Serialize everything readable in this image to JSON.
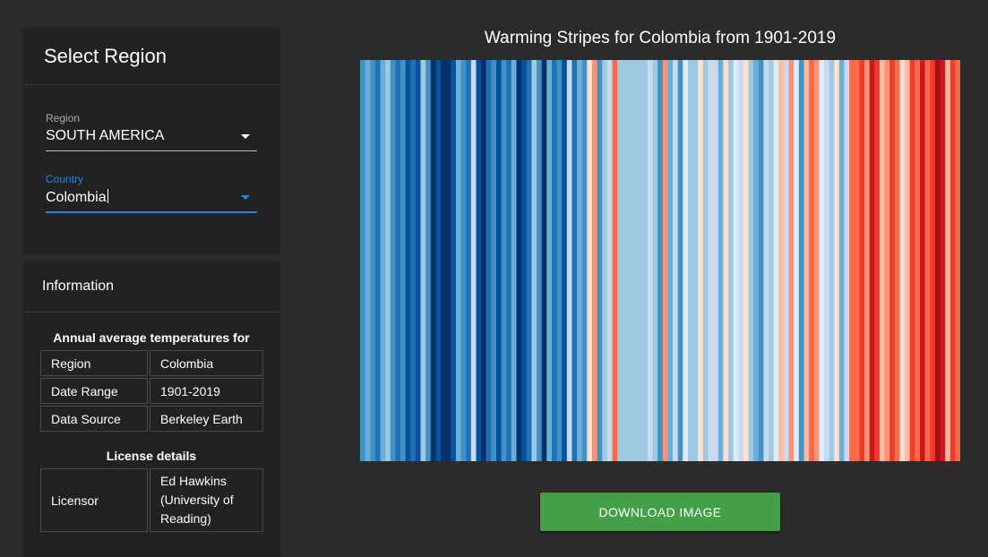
{
  "sidebar": {
    "select_title": "Select Region",
    "region_field": {
      "label": "Region",
      "value": "SOUTH AMERICA"
    },
    "country_field": {
      "label": "Country",
      "value": "Colombia"
    },
    "info_title": "Information",
    "annual_heading": "Annual average temperatures for",
    "details": [
      {
        "key": "Region",
        "value": "Colombia"
      },
      {
        "key": "Date Range",
        "value": "1901-2019"
      },
      {
        "key": "Data Source",
        "value": "Berkeley Earth"
      }
    ],
    "license_heading": "License details",
    "license": [
      {
        "key": "Licensor",
        "value": "Ed Hawkins (University of Reading)"
      }
    ]
  },
  "main": {
    "download_label": "DOWNLOAD IMAGE"
  },
  "colors": {
    "accent": "#1e88e5",
    "button": "#43a047",
    "palette": [
      "#08306b",
      "#08519c",
      "#2171b5",
      "#4292c6",
      "#6baed6",
      "#9ecae1",
      "#c6dbef",
      "#deebf7",
      "#fee0d2",
      "#fcbba1",
      "#fc9272",
      "#fb6a4a",
      "#ef3b2c",
      "#cb181d",
      "#a50f15"
    ]
  },
  "chart_data": {
    "type": "heatmap",
    "title": "Warming Stripes for Colombia from 1901-2019",
    "x": [
      1901,
      2019
    ],
    "values": [
      3,
      4,
      3,
      2,
      4,
      5,
      3,
      2,
      3,
      1,
      2,
      1,
      5,
      3,
      0,
      1,
      0,
      0,
      1,
      4,
      3,
      2,
      6,
      1,
      0,
      2,
      3,
      1,
      3,
      2,
      4,
      0,
      1,
      2,
      5,
      3,
      0,
      4,
      2,
      3,
      1,
      6,
      2,
      4,
      3,
      8,
      10,
      3,
      5,
      6,
      11,
      5,
      5,
      5,
      5,
      5,
      5,
      6,
      5,
      3,
      10,
      4,
      6,
      3,
      7,
      5,
      5,
      8,
      5,
      6,
      6,
      4,
      8,
      5,
      7,
      6,
      8,
      5,
      4,
      3,
      6,
      5,
      7,
      9,
      6,
      10,
      7,
      3,
      9,
      11,
      10,
      7,
      6,
      5,
      8,
      4,
      6,
      11,
      11,
      12,
      10,
      13,
      12,
      9,
      10,
      12,
      11,
      8,
      9,
      12,
      11,
      13,
      11,
      12,
      14,
      13,
      9,
      12,
      11
    ]
  }
}
